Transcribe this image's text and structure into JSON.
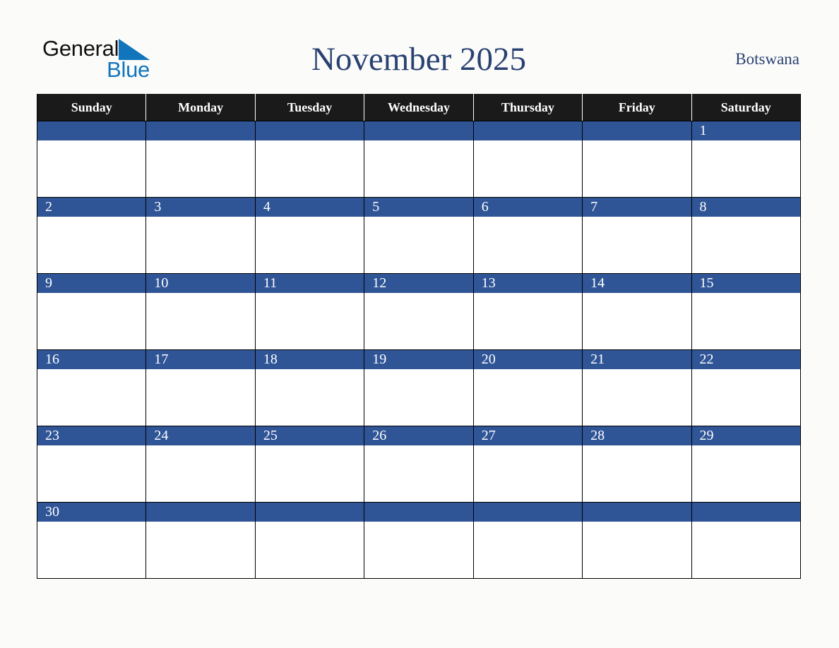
{
  "brand": {
    "name_part1": "General",
    "name_part2": "Blue",
    "triangle_icon": "right-triangle-icon",
    "color_dark": "#111111",
    "color_blue": "#1275bc"
  },
  "header": {
    "title": "November 2025",
    "country": "Botswana",
    "title_color": "#2a4272"
  },
  "calendar": {
    "month": "November",
    "year": "2025",
    "header_bg": "#1a1a1a",
    "daynum_bg": "#2f5597",
    "cell_bg": "#ffffff",
    "grid_color": "#000000",
    "weekdays": [
      "Sunday",
      "Monday",
      "Tuesday",
      "Wednesday",
      "Thursday",
      "Friday",
      "Saturday"
    ],
    "weeks": [
      [
        "",
        "",
        "",
        "",
        "",
        "",
        "1"
      ],
      [
        "2",
        "3",
        "4",
        "5",
        "6",
        "7",
        "8"
      ],
      [
        "9",
        "10",
        "11",
        "12",
        "13",
        "14",
        "15"
      ],
      [
        "16",
        "17",
        "18",
        "19",
        "20",
        "21",
        "22"
      ],
      [
        "23",
        "24",
        "25",
        "26",
        "27",
        "28",
        "29"
      ],
      [
        "30",
        "",
        "",
        "",
        "",
        "",
        ""
      ]
    ]
  }
}
